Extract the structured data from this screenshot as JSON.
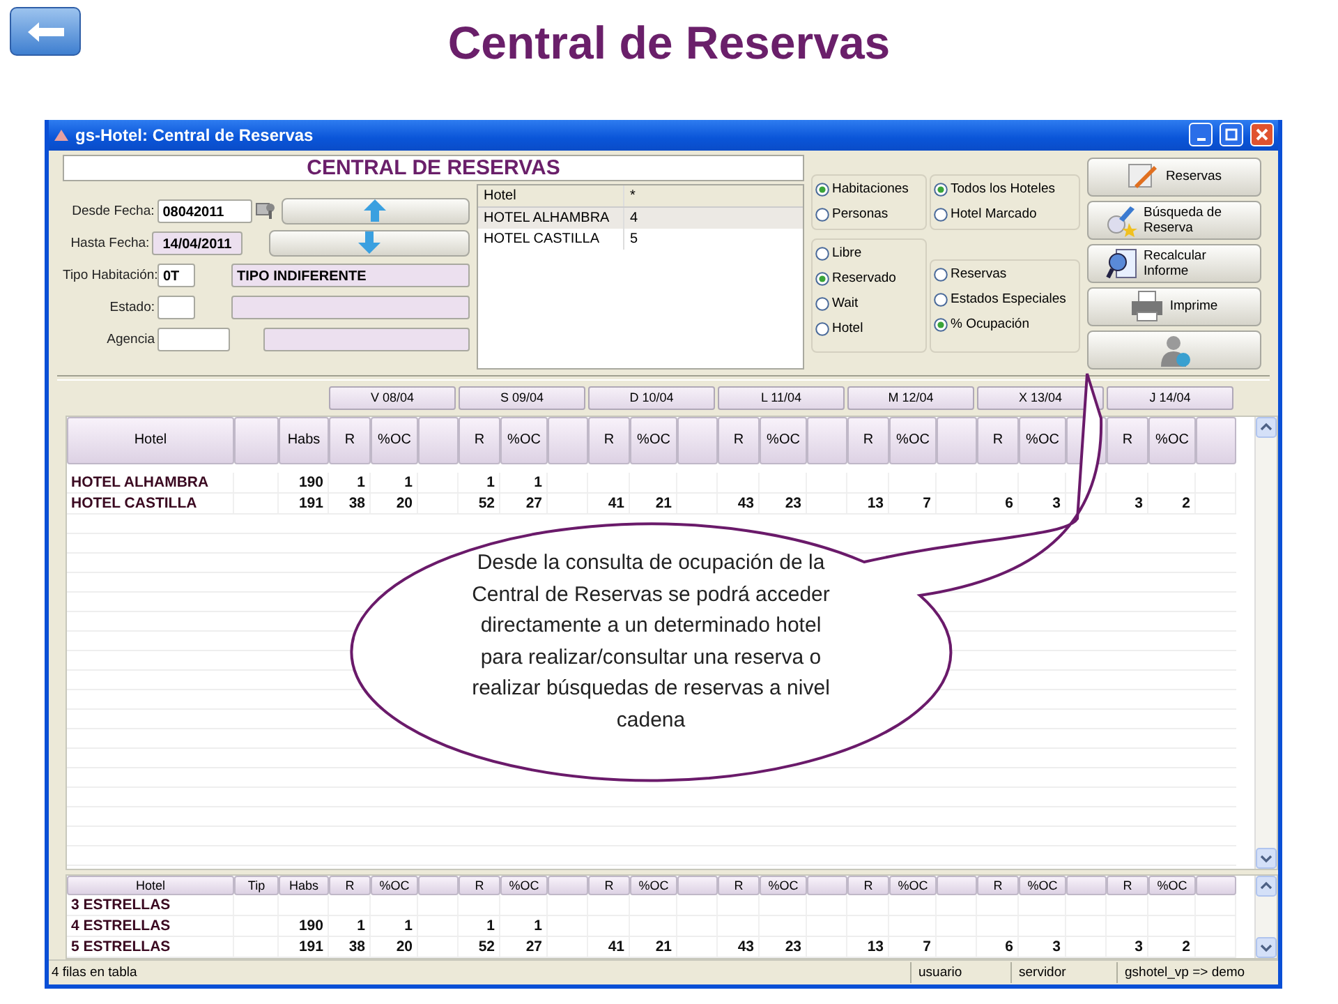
{
  "slide": {
    "title": "Central de Reservas"
  },
  "window": {
    "title": "gs-Hotel: Central de Reservas"
  },
  "header": {
    "title": "CENTRAL DE RESERVAS"
  },
  "form": [
    {
      "kind": "date_from",
      "label": "Desde Fecha:",
      "value": "08042011"
    },
    {
      "kind": "date_to",
      "label": "Hasta Fecha:",
      "value": "14/04/2011"
    },
    {
      "kind": "code",
      "label": "Tipo Habitación:",
      "value": "0T",
      "description": "TIPO INDIFERENTE"
    },
    {
      "kind": "code",
      "label": "Estado:"
    },
    {
      "kind": "agency",
      "label": "Agencia"
    }
  ],
  "hotel_list": {
    "columns": [
      "Hotel",
      "*"
    ],
    "rows": [
      {
        "name": "HOTEL ALHAMBRA",
        "category": "4",
        "selected": true
      },
      {
        "name": "HOTEL CASTILLA",
        "category": "5",
        "selected": false
      }
    ]
  },
  "option_groups": [
    {
      "items": [
        {
          "label": "Habitaciones",
          "selected": true
        },
        {
          "label": "Personas",
          "selected": false
        }
      ]
    },
    {
      "items": [
        {
          "label": "Todos los Hoteles",
          "selected": true
        },
        {
          "label": "Hotel Marcado",
          "selected": false
        }
      ]
    },
    {
      "items": [
        {
          "label": "Libre",
          "selected": false
        },
        {
          "label": "Reservado",
          "selected": true
        },
        {
          "label": "Wait",
          "selected": false
        },
        {
          "label": "Hotel",
          "selected": false
        }
      ]
    },
    {
      "items": [
        {
          "label": "Reservas",
          "selected": false
        },
        {
          "label": "Estados Especiales",
          "selected": false
        },
        {
          "label": "% Ocupación",
          "selected": true
        }
      ]
    }
  ],
  "actions": [
    {
      "kind": "labeled",
      "label": "Reservas"
    },
    {
      "kind": "labeled",
      "label": "Búsqueda de Reserva"
    },
    {
      "kind": "labeled",
      "label": "Recalcular Informe"
    },
    {
      "kind": "labeled",
      "label": "Imprime"
    },
    {
      "kind": "icon_only"
    }
  ],
  "grid": {
    "hotel": "Hotel",
    "habs": "Habs",
    "days": [
      {
        "date": "V 08/04",
        "r": "R",
        "oc": "%OC"
      },
      {
        "date": "S 09/04",
        "r": "R",
        "oc": "%OC"
      },
      {
        "date": "D 10/04",
        "r": "R",
        "oc": "%OC"
      },
      {
        "date": "L 11/04",
        "r": "R",
        "oc": "%OC"
      },
      {
        "date": "M 12/04",
        "r": "R",
        "oc": "%OC"
      },
      {
        "date": "X 13/04",
        "r": "R",
        "oc": "%OC"
      },
      {
        "date": "J 14/04",
        "r": "R",
        "oc": "%OC"
      }
    ],
    "rows": [
      {
        "hotel": "HOTEL ALHAMBRA",
        "habs": "190",
        "cells": [
          "1",
          "1",
          "1",
          "1",
          null,
          null,
          null,
          null,
          null,
          null,
          null,
          null,
          null,
          null
        ]
      },
      {
        "hotel": "HOTEL CASTILLA",
        "habs": "191",
        "cells": [
          "38",
          "20",
          "52",
          "27",
          "41",
          "21",
          "43",
          "23",
          "13",
          "7",
          "6",
          "3",
          "3",
          "2"
        ]
      }
    ]
  },
  "summary": {
    "hotel": "Hotel",
    "tip": "Tip",
    "habs": "Habs",
    "days": [
      {
        "r": "R",
        "oc": "%OC"
      },
      {
        "r": "R",
        "oc": "%OC"
      },
      {
        "r": "R",
        "oc": "%OC"
      },
      {
        "r": "R",
        "oc": "%OC"
      },
      {
        "r": "R",
        "oc": "%OC"
      },
      {
        "r": "R",
        "oc": "%OC"
      },
      {
        "r": "R",
        "oc": "%OC"
      }
    ],
    "rows": [
      {
        "hotel": "3 ESTRELLAS",
        "cells": [
          null,
          null,
          null,
          null,
          null,
          null,
          null,
          null,
          null,
          null,
          null,
          null,
          null,
          null
        ]
      },
      {
        "hotel": "4 ESTRELLAS",
        "habs": "190",
        "cells": [
          "1",
          "1",
          "1",
          "1",
          null,
          null,
          null,
          null,
          null,
          null,
          null,
          null,
          null,
          null
        ]
      },
      {
        "hotel": "5 ESTRELLAS",
        "habs": "191",
        "cells": [
          "38",
          "20",
          "52",
          "27",
          "41",
          "21",
          "43",
          "23",
          "13",
          "7",
          "6",
          "3",
          "3",
          "2"
        ]
      }
    ]
  },
  "status_bar": {
    "message": "4 filas en tabla",
    "fields": [
      "usuario",
      "servidor",
      "gshotel_vp => demo"
    ]
  },
  "callout": {
    "text": "Desde la consulta de ocupación de la Central de Reservas se podrá acceder directamente a un determinado hotel para realizar/consultar una reserva o realizar búsquedas de reservas a nivel cadena"
  }
}
